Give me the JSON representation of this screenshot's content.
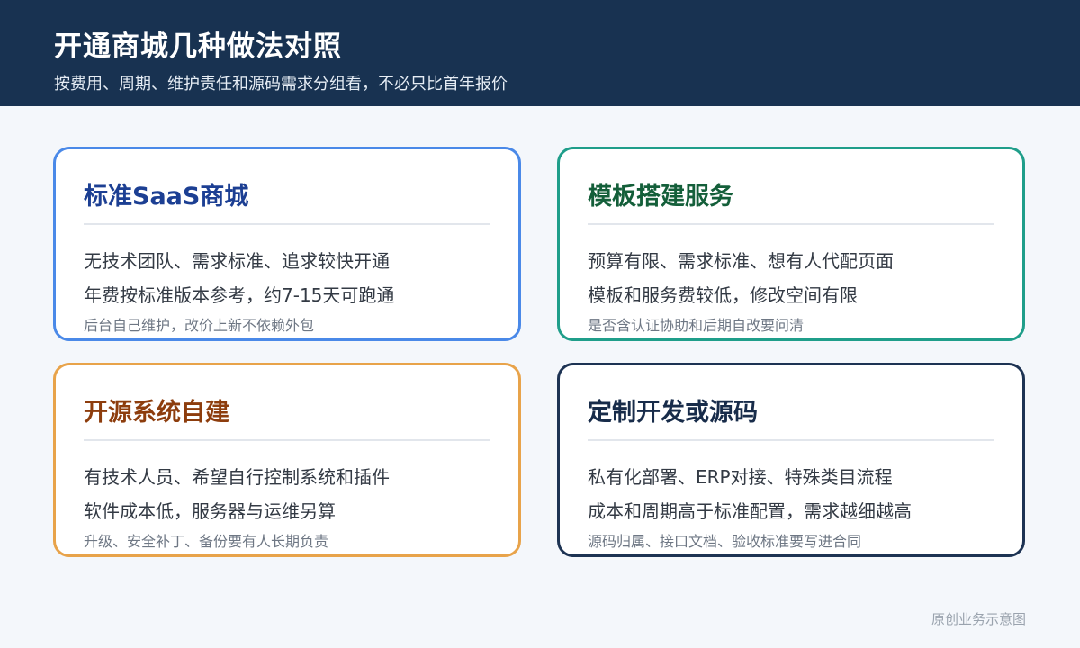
{
  "header": {
    "title": "开通商城几种做法对照",
    "subtitle": "按费用、周期、维护责任和源码需求分组看，不必只比首年报价"
  },
  "cards": [
    {
      "title": "标准SaaS商城",
      "line1": "无技术团队、需求标准、追求较快开通",
      "line2": "年费按标准版本参考，约7-15天可跑通",
      "note": "后台自己维护，改价上新不依赖外包"
    },
    {
      "title": "模板搭建服务",
      "line1": "预算有限、需求标准、想有人代配页面",
      "line2": "模板和服务费较低，修改空间有限",
      "note": "是否含认证协助和后期自改要问清"
    },
    {
      "title": "开源系统自建",
      "line1": "有技术人员、希望自行控制系统和插件",
      "line2": "软件成本低，服务器与运维另算",
      "note": "升级、安全补丁、备份要有人长期负责"
    },
    {
      "title": "定制开发或源码",
      "line1": "私有化部署、ERP对接、特殊类目流程",
      "line2": "成本和周期高于标准配置，需求越细越高",
      "note": "源码归属、接口文档、验收标准要写进合同"
    }
  ],
  "footer": {
    "note": "原创业务示意图"
  },
  "colors": {
    "header_bg": "#183251",
    "card1_border": "#4a89e8",
    "card2_border": "#1f9e8a",
    "card3_border": "#e8a34a",
    "card4_border": "#1d3353"
  }
}
